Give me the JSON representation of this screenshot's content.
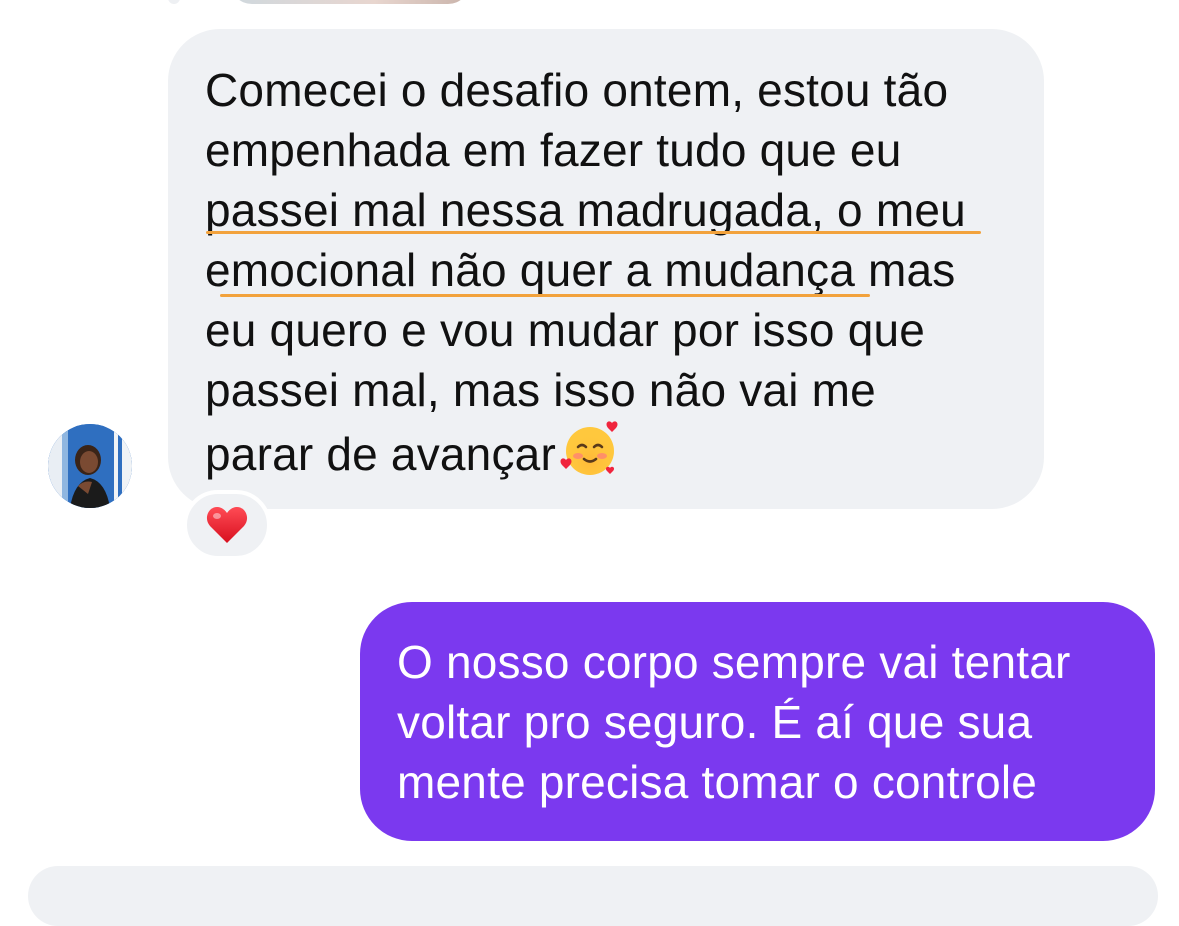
{
  "conversation": {
    "incoming_message": {
      "lines": [
        "Comecei o desafio ontem, estou tão",
        "empenhada em fazer tudo que eu",
        "passei mal nessa madrugada, o meu",
        "emocional não quer a mudança mas",
        "eu quero e vou mudar por isso que",
        "passei mal, mas isso não vai me",
        "parar de avançar"
      ],
      "emoji": "smiling-face-with-hearts",
      "reaction": "heart",
      "highlight_color": "#f2a23c",
      "bubble_color": "#eff1f4"
    },
    "outgoing_message": {
      "lines": [
        "O nosso corpo sempre vai tentar",
        "voltar pro seguro. É aí que sua",
        "mente precisa tomar o controle"
      ],
      "bubble_color": "#7b39ef"
    }
  }
}
